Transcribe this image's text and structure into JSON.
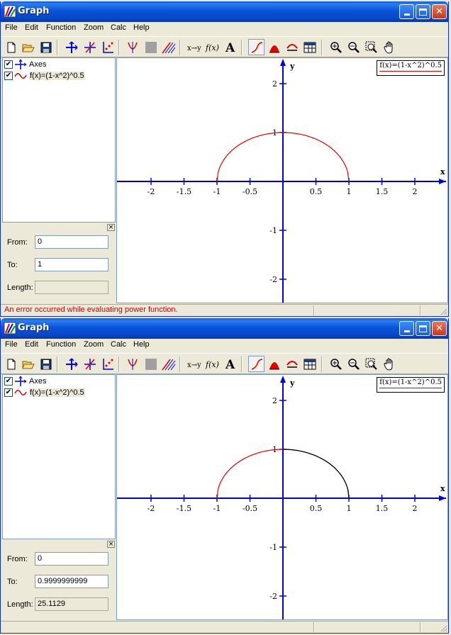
{
  "windows": [
    {
      "title": "Graph",
      "menu": [
        "File",
        "Edit",
        "Function",
        "Zoom",
        "Calc",
        "Help"
      ],
      "tree": [
        {
          "label": "Axes",
          "checked": true,
          "icon": "axes-icon"
        },
        {
          "label": "f(x)=(1-x^2)^0.5",
          "checked": true,
          "icon": "function-curve-icon"
        }
      ],
      "props": {
        "from_label": "From:",
        "from_value": "0",
        "to_label": "To:",
        "to_value": "1",
        "length_label": "Length:",
        "length_value": ""
      },
      "legend": "f(x)=(1-x^2)^0.5",
      "x_axis_label": "x",
      "y_axis_label": "y",
      "x_ticks": [
        "-2",
        "-1.5",
        "-1",
        "-0.5",
        "0.5",
        "1",
        "1.5",
        "2"
      ],
      "y_ticks": [
        "2",
        "1",
        "-1",
        "-2"
      ],
      "status": "An error occurred while evaluating power function.",
      "status_color": "#cc0000",
      "highlight_segment": "none"
    },
    {
      "title": "Graph",
      "menu": [
        "File",
        "Edit",
        "Function",
        "Zoom",
        "Calc",
        "Help"
      ],
      "tree": [
        {
          "label": "Axes",
          "checked": true,
          "icon": "axes-icon"
        },
        {
          "label": "f(x)=(1-x^2)^0.5",
          "checked": true,
          "icon": "function-curve-icon"
        }
      ],
      "props": {
        "from_label": "From:",
        "from_value": "0",
        "to_label": "To:",
        "to_value": "0.9999999999",
        "length_label": "Length:",
        "length_value": "25.1129"
      },
      "legend": "f(x)=(1-x^2)^0.5",
      "x_axis_label": "x",
      "y_axis_label": "y",
      "x_ticks": [
        "-2",
        "-1.5",
        "-1",
        "-0.5",
        "0.5",
        "1",
        "1.5",
        "2"
      ],
      "y_ticks": [
        "2",
        "1",
        "-1",
        "-2"
      ],
      "status": "",
      "status_color": "#000000",
      "highlight_segment": "from 0 to 1"
    }
  ],
  "colors": {
    "axis": "#0000e0",
    "curve": "#e00000",
    "highlight": "#000000"
  },
  "chart_data": [
    {
      "type": "line",
      "title": "",
      "xlabel": "x",
      "ylabel": "y",
      "xlim": [
        -2.5,
        2.5
      ],
      "ylim": [
        -2.5,
        2.5
      ],
      "series": [
        {
          "name": "f(x)=(1-x^2)^0.5",
          "function": "(1-x^2)^0.5",
          "domain": [
            -1,
            1
          ]
        }
      ],
      "grid": false,
      "legend": "top-right"
    },
    {
      "type": "line",
      "title": "",
      "xlabel": "x",
      "ylabel": "y",
      "xlim": [
        -2.5,
        2.5
      ],
      "ylim": [
        -2.5,
        2.5
      ],
      "series": [
        {
          "name": "f(x)=(1-x^2)^0.5",
          "function": "(1-x^2)^0.5",
          "domain": [
            -1,
            1
          ]
        }
      ],
      "highlighted_range": [
        0,
        0.9999999999
      ],
      "grid": false,
      "legend": "top-right"
    }
  ]
}
